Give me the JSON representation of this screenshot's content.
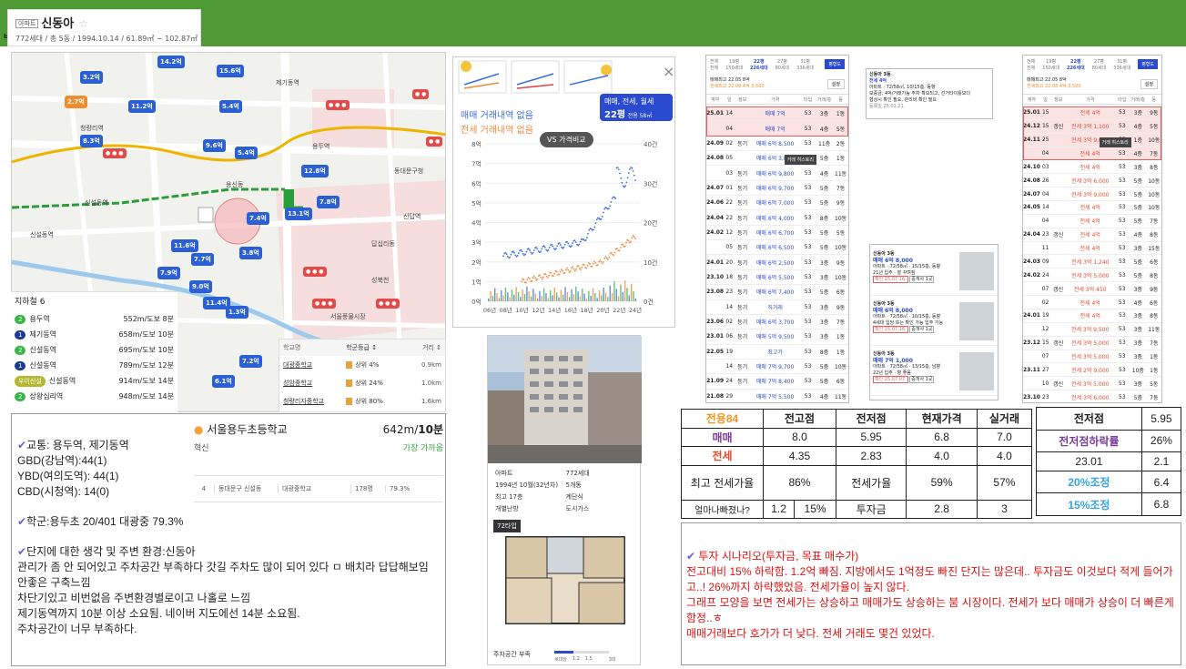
{
  "header": {
    "tag": "아파트",
    "name": "신동아",
    "star": "☆",
    "summary": "772세대 / 총 5동 / 1994.10.14 / 61.89㎡ ~ 102.87㎡",
    "side_char": "ㅂ",
    "bar_color": "#4e9a35"
  },
  "map": {
    "pins": [
      "14.2억",
      "3.2억",
      "15.6억",
      "2.7억",
      "5.4억",
      "11.2억",
      "8.3억",
      "9.6억",
      "5.4억",
      "12.8억",
      "7.8억",
      "13.1억",
      "7.4억",
      "11.6억",
      "3.8억",
      "7.7억",
      "7.9억",
      "9.0억",
      "11.4억",
      "1.3억",
      "7.2억",
      "6.1억"
    ],
    "labels": [
      "청량리역",
      "용두역",
      "제기동역",
      "신설동역",
      "신답역",
      "용신동",
      "답십리동",
      "동대문구청",
      "서울풍물시장",
      "성북천",
      "신설동역"
    ],
    "subway_title": "지하철 6",
    "subway": [
      {
        "line": "2",
        "color": "#3ab54a",
        "name": "용두역",
        "dist": "552m/도보 8분"
      },
      {
        "line": "1",
        "color": "#1a3c8f",
        "name": "제기동역",
        "dist": "658m/도보 10분"
      },
      {
        "line": "2",
        "color": "#3ab54a",
        "name": "신설동역",
        "dist": "695m/도보 10분"
      },
      {
        "line": "1",
        "color": "#1a3c8f",
        "name": "신설동역",
        "dist": "789m/도보 12분"
      },
      {
        "line": "우이신설",
        "color": "#b5b82f",
        "name": "신설동역",
        "dist": "914m/도보 14분"
      },
      {
        "line": "2",
        "color": "#3ab54a",
        "name": "상왕십리역",
        "dist": "948m/도보 14분"
      }
    ],
    "school_hdr": [
      "학교명",
      "학군등급 ↕",
      "거리 ↕"
    ],
    "schools": [
      {
        "name": "대광중학교",
        "grade": "상위 4%",
        "dist": "0.9km"
      },
      {
        "name": "성암중학교",
        "grade": "상위 24%",
        "dist": "1.0km"
      },
      {
        "name": "청량리자중학교",
        "grade": "상위 80%",
        "dist": "1.6km"
      }
    ]
  },
  "chart": {
    "legend1": "매매 거래내역 없음",
    "legend2": "전세 거래내역 없음",
    "vs": "VS 가격비교",
    "badge_top": "매매, 전세, 월세",
    "badge_size": "22평",
    "badge_area": "전용 58㎡",
    "close": "×",
    "y_left": [
      "8억",
      "7억",
      "6억",
      "5억",
      "4억",
      "3억",
      "2억",
      "1억",
      "0억"
    ],
    "y_right": [
      "40건",
      "30건",
      "20건",
      "10건",
      "0건"
    ],
    "x_ticks": [
      "06년",
      "08년",
      "10년",
      "12년",
      "14년",
      "16년",
      "18년",
      "20년",
      "22년",
      "24년"
    ]
  },
  "building": {
    "facts": [
      "아파트",
      "772세대",
      "1994년 10월(32년차)",
      "5개동",
      "최고 17층",
      "계단식",
      "개별난방",
      "도시가스"
    ],
    "plan_tag": "72타입",
    "parking": "주차공간 부족",
    "parking_scale": [
      "세대당",
      "1.2",
      "1.5",
      "3대"
    ]
  },
  "trades_left": {
    "tabs": [
      "전체",
      "19평",
      "22평",
      "27평",
      "31평"
    ],
    "tabs_sub": [
      "전체",
      "150세대",
      "226세대",
      "80세대",
      "336세대"
    ],
    "btn": "평형도",
    "max1": "매매최고 22.05 8억",
    "max2": "전세최고 22.08 4억 3,500",
    "btn2": "설정",
    "cols": [
      "계약",
      "일",
      "정보",
      "가격",
      "타입",
      "거래/층",
      "동"
    ],
    "rows": [
      [
        "25.01",
        "14",
        "",
        "매매 7억",
        "53",
        "3층",
        "1동"
      ],
      [
        "",
        "04",
        "",
        "매매 7억",
        "53",
        "4층",
        "5동"
      ],
      [
        "24.09",
        "02",
        "등기",
        "매매 6억 8,500",
        "53",
        "11층",
        "2동"
      ],
      [
        "24.08",
        "05",
        "",
        "매매 6억 3,800",
        "53",
        "5층",
        "1동"
      ],
      [
        "",
        "03",
        "등기",
        "매매 6억 9,800",
        "53",
        "4층",
        "11동"
      ],
      [
        "24.07",
        "01",
        "등기",
        "매매 6억 9,700",
        "53",
        "5층",
        "7동"
      ],
      [
        "24.06",
        "22",
        "등기",
        "매매 6억 7,000",
        "53",
        "5층",
        "9동"
      ],
      [
        "24.04",
        "22",
        "등기",
        "매매 6억 4,000",
        "53",
        "8층",
        "10동"
      ],
      [
        "24.02",
        "12",
        "등기",
        "매매 6억 6,700",
        "53",
        "5층",
        "5동"
      ],
      [
        "",
        "05",
        "등기",
        "매매 6억 6,500",
        "53",
        "5층",
        "10동"
      ],
      [
        "24.01",
        "20",
        "등기",
        "매매 6억 2,500",
        "53",
        "3층",
        "9동"
      ],
      [
        "23.10",
        "18",
        "등기",
        "매매 6억 5,500",
        "53",
        "3층",
        "10동"
      ],
      [
        "23.08",
        "23",
        "등기",
        "매매 6억 7,400",
        "53",
        "5층",
        "6동"
      ],
      [
        "",
        "14",
        "등기",
        "직거래",
        "53",
        "3층",
        "9동"
      ],
      [
        "23.06",
        "02",
        "등기",
        "매매 6억 3,700",
        "53",
        "3층",
        "7동"
      ],
      [
        "23.01",
        "06",
        "등기",
        "매매 5억 9,500",
        "53",
        "3층",
        "1동"
      ],
      [
        "22.05",
        "19",
        "",
        "최고가",
        "53",
        "8층",
        "1동"
      ],
      [
        "",
        "14",
        "등기",
        "매매 7억 9,700",
        "53",
        "5층",
        "10동"
      ],
      [
        "21.09",
        "24",
        "등기",
        "매매 7억 8,400",
        "53",
        "5층",
        "6동"
      ],
      [
        "21.08",
        "29",
        "",
        "매매 7억 5,500",
        "53",
        "4층",
        "11동"
      ]
    ],
    "tooltip": "거래 히스토리"
  },
  "listings": {
    "mini": [
      "신동아 3동",
      "전세 4억",
      "아파트 · 72/58㎡, 10/15층, 동향",
      "보증금, 4억/거래가능 주차 확보되고, 선거타이틀보더",
      "협상시 확인 필요, 관리비 확인 필요",
      "등록일 25.01.21."
    ],
    "cards": [
      {
        "name": "신동아 3동",
        "price": "매매 6억 8,000",
        "desc": "아파트 · 72/58㎡ · 15/15층, 동향",
        "note": "21년 입주 · 잘 꾸며짐",
        "date": "확인 25.07.16.",
        "tag": "중개사 1곳"
      },
      {
        "name": "신동아 3동",
        "price": "매매 6억 8,000",
        "desc": "아파트 · 72/58㎡ · 10/15층, 동향",
        "note": "4세대 입당 또는 확인 가능 입주 가능",
        "date": "확인 25.07.16.",
        "tag": "중개사 1곳"
      },
      {
        "name": "신동아 3동",
        "price": "매매 7억 1,000",
        "desc": "아파트 · 72/58㎡ · 13/15층, 남향",
        "note": "22년 입주 · 향 좋음",
        "date": "확인 25.07.07.",
        "tag": "중개사 1곳"
      }
    ]
  },
  "trades_right": {
    "tabs": [
      "전체",
      "19평",
      "22평",
      "27평",
      "31평"
    ],
    "tabs_sub": [
      "전체",
      "150세대",
      "226세대",
      "80세대",
      "336세대"
    ],
    "btn": "평형도",
    "max1": "매매최고 22.05 8억",
    "max2": "전세최고 22.08 4억 3,500",
    "btn2": "설정",
    "cols": [
      "계약",
      "일",
      "정보",
      "가격",
      "타입",
      "거래/층",
      "동"
    ],
    "rows": [
      [
        "25.01",
        "15",
        "",
        "전세 4억",
        "53",
        "3층",
        "9동"
      ],
      [
        "24.12",
        "15",
        "갱신",
        "전세 3억 1,100",
        "53",
        "4층",
        "5동"
      ],
      [
        "24.11",
        "25",
        "",
        "전세 3억 9,000",
        "53",
        "1층",
        "10동"
      ],
      [
        "",
        "04",
        "",
        "전세 4억",
        "53",
        "4층",
        "7동"
      ],
      [
        "24.10",
        "03",
        "",
        "전세 4억",
        "53",
        "3층",
        "8동"
      ],
      [
        "24.08",
        "26",
        "",
        "전세 3억 6,000",
        "53",
        "5층",
        "10동"
      ],
      [
        "24.07",
        "04",
        "",
        "전세 3억 9,000",
        "53",
        "5층",
        "10동"
      ],
      [
        "24.05",
        "14",
        "",
        "전세 4억",
        "53",
        "5층",
        "10동"
      ],
      [
        "",
        "04",
        "",
        "전세 4억",
        "53",
        "5층",
        "7동"
      ],
      [
        "24.04",
        "23",
        "갱신",
        "전세 4억",
        "53",
        "4층",
        "8동"
      ],
      [
        "",
        "11",
        "",
        "전세 4억",
        "53",
        "3층",
        "15동"
      ],
      [
        "24.03",
        "09",
        "",
        "전세 3억 1,240",
        "53",
        "5층",
        "6동"
      ],
      [
        "24.02",
        "24",
        "",
        "전세 3억 5,000",
        "53",
        "5층",
        "8동"
      ],
      [
        "",
        "07",
        "갱신",
        "전세 3억 450",
        "53",
        "3층",
        "9동"
      ],
      [
        "",
        "02",
        "",
        "전세 4억",
        "53",
        "4층",
        "6동"
      ],
      [
        "24.01",
        "19",
        "",
        "전세 4억",
        "53",
        "3층",
        "8동"
      ],
      [
        "",
        "12",
        "",
        "전세 3억 9,500",
        "53",
        "3층",
        "11동"
      ],
      [
        "23.12",
        "15",
        "갱신",
        "전세 3억 5,000",
        "53",
        "3층",
        "7동"
      ],
      [
        "",
        "07",
        "",
        "전세 3억 5,000",
        "53",
        "3층",
        "1동"
      ],
      [
        "23.11",
        "27",
        "",
        "전세 2억 9,000",
        "53",
        "10층",
        "1동"
      ],
      [
        "",
        "10",
        "갱신",
        "전세 3억 5,000",
        "53",
        "3층",
        "5동"
      ],
      [
        "23.10",
        "23",
        "",
        "전세 3억 6,000",
        "53",
        "5층",
        "7동"
      ]
    ],
    "tooltip": "거래 히스토리"
  },
  "table1": {
    "head": [
      "전용84",
      "전고점",
      "전저점",
      "현재가격",
      "실거래"
    ],
    "r1": [
      "매매",
      "8.0",
      "5.95",
      "6.8",
      "7.0"
    ],
    "r2": [
      "전세",
      "4.35",
      "2.83",
      "4.0",
      "4.0"
    ],
    "r3": [
      "최고 전세가율",
      "86%",
      "전세가율",
      "59%",
      "57%"
    ],
    "r4": [
      "얼마나빠졌나?",
      "1.2",
      "15%",
      "투자금",
      "2.8",
      "3"
    ]
  },
  "table2": {
    "rows": [
      [
        "전저점",
        "5.95"
      ],
      [
        "전저점하락률",
        "26%"
      ],
      [
        "23.01",
        "2.1"
      ],
      [
        "20%조정",
        "6.4"
      ],
      [
        "15%조정",
        "6.8"
      ]
    ]
  },
  "school_card": {
    "name": "서울용두초등학교",
    "dist": "642m/",
    "dist_b": "10분",
    "type": "혁신",
    "near": "가장 가까움",
    "row": [
      "4",
      "동대문구 신설동",
      "대광중학교",
      "178명",
      "79.3%"
    ]
  },
  "note1": {
    "check": "✔",
    "traffic_h": "교통: 용두역, 제기동역",
    "gbd": "GBD(강남역):44(1)",
    "ybd": "YBD(여의도역): 44(1)",
    "cbd": "CBD(시청역): 14(0)",
    "school": "학군:용두초 20/401 대광중 79.3%",
    "env_h": "단지에 대한 생각 및 주변 환경:신동아",
    "env1": "관리가 좀 안 되어있고 주차공간 부족하다 갓길 주차도 많이 되어 있다 ㅁ 배치라 답답해보임 안좋은 구축느낌",
    "env2": "차단기있고 비번없음 주변환경별로이고 나홀로 느낌",
    "env3": "제기동역까지 10분 이상 소요됨. 네이버 지도에선 14분 소요됨.",
    "env4": "주차공간이 너무 부족하다."
  },
  "note2": {
    "check": "✔",
    "h": "투자 시나리오(투자금, 목표 매수가)",
    "l1": "전고대비 15% 하락함. 1.2억 빠짐. 지방에서도 1억정도 빠진 단지는 많은데.. 투자금도 이것보다 적게 들어가고..! 26%까지 하락했었음. 전세가율이 높지 않다.",
    "l2": "그래프 모양을 보면 전세가는 상승하고 매매가도 상승하는 붐 시장이다. 전세가 보다 매매가 상승이 더 빠른게 함정..ㅎ",
    "l3": "매매거래보다 호가가 더 낮다. 전세 거래도 몇건 있었다."
  }
}
